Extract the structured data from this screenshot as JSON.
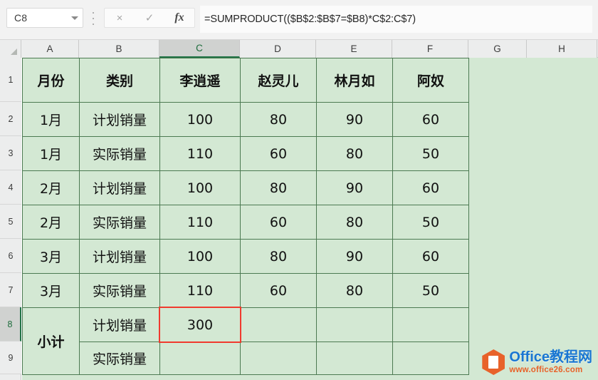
{
  "namebox": {
    "value": "C8",
    "dropdown_icon": "chevron-down-icon"
  },
  "formula_toolbar": {
    "cancel_icon": "close-icon",
    "confirm_icon": "check-icon",
    "function_icon": "fx-icon",
    "cancel_label": "×",
    "confirm_label": "✓",
    "function_label": "fx"
  },
  "formula_bar": {
    "value": "=SUMPRODUCT(($B$2:$B$7=$B8)*C$2:C$7)",
    "placeholder": ""
  },
  "column_headers": [
    "A",
    "B",
    "C",
    "D",
    "E",
    "F",
    "G",
    "H"
  ],
  "selected_column": "C",
  "row_headers": [
    "1",
    "2",
    "3",
    "4",
    "5",
    "6",
    "7",
    "8",
    "9"
  ],
  "selected_row": "8",
  "selected_cell": "C8",
  "selection_color": "#f03a2e",
  "sheet_fill": "#d3e8d3",
  "border_color": "#4c7a52",
  "table": {
    "headers": [
      "月份",
      "类别",
      "李逍遥",
      "赵灵儿",
      "林月如",
      "阿奴"
    ],
    "rows": [
      {
        "month": "1月",
        "category": "计划销量",
        "values": [
          "100",
          "80",
          "90",
          "60"
        ]
      },
      {
        "month": "1月",
        "category": "实际销量",
        "values": [
          "110",
          "60",
          "80",
          "50"
        ]
      },
      {
        "month": "2月",
        "category": "计划销量",
        "values": [
          "100",
          "80",
          "90",
          "60"
        ]
      },
      {
        "month": "2月",
        "category": "实际销量",
        "values": [
          "110",
          "60",
          "80",
          "50"
        ]
      },
      {
        "month": "3月",
        "category": "计划销量",
        "values": [
          "100",
          "80",
          "90",
          "60"
        ]
      },
      {
        "month": "3月",
        "category": "实际销量",
        "values": [
          "110",
          "60",
          "80",
          "50"
        ]
      }
    ],
    "subtotal": {
      "label": "小计",
      "rows": [
        {
          "category": "计划销量",
          "values": [
            "300",
            "",
            "",
            ""
          ]
        },
        {
          "category": "实际销量",
          "values": [
            "",
            "",
            "",
            ""
          ]
        }
      ]
    }
  },
  "watermark": {
    "logo_icon": "office-hexagon-logo",
    "title": "Office教程网",
    "url": "www.office26.com",
    "title_color": "#1976d2",
    "url_color": "#e8622a"
  }
}
